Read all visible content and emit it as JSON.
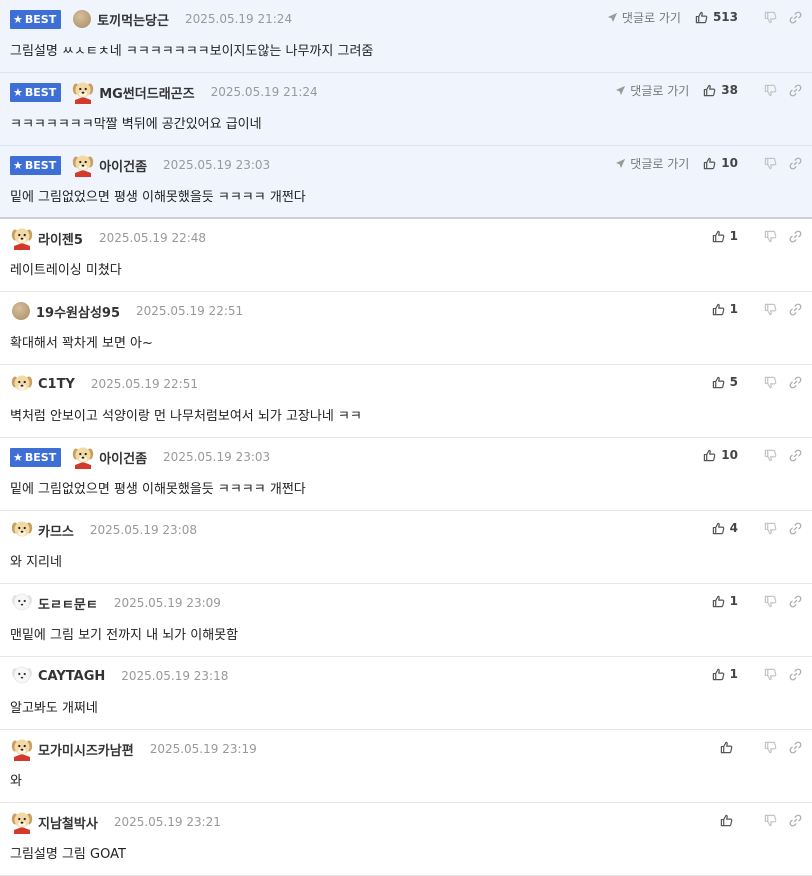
{
  "labels": {
    "best": "BEST",
    "reply": "댓글로 가기"
  },
  "colors": {
    "best_badge": "#3d6fd6",
    "best_bg": "#f0f4fd"
  },
  "comments": [
    {
      "best": true,
      "avatar": "ball",
      "nick": "토끼먹는당근",
      "date": "2025.05.19 21:24",
      "text": "그림설명 ㅆㅅㅌㅊ네 ㅋㅋㅋㅋㅋㅋㅋ보이지도않는 나무까지 그려줌",
      "likes": "513",
      "reply": true
    },
    {
      "best": true,
      "avatar": "dog-red",
      "nick": "MG썬더드래곤즈",
      "date": "2025.05.19 21:24",
      "text": "ㅋㅋㅋㅋㅋㅋㅋ막짤 벽뒤에 공간있어요 급이네",
      "likes": "38",
      "reply": true
    },
    {
      "best": true,
      "avatar": "dog-red",
      "nick": "아이건좀",
      "date": "2025.05.19 23:03",
      "text": "밑에 그림없었으면 평생 이해못했을듯 ㅋㅋㅋㅋ 개쩐다",
      "likes": "10",
      "reply": true
    },
    {
      "best": false,
      "avatar": "dog-red",
      "nick": "라이젠5",
      "date": "2025.05.19 22:48",
      "text": "레이트레이싱 미쳤다",
      "likes": "1",
      "reply": false
    },
    {
      "best": false,
      "avatar": "ball",
      "nick": "19수원삼성95",
      "date": "2025.05.19 22:51",
      "text": "확대해서 꽉차게 보면 아~",
      "likes": "1",
      "reply": false
    },
    {
      "best": false,
      "avatar": "dog",
      "nick": "C1TY",
      "date": "2025.05.19 22:51",
      "text": "벽처럼 안보이고 석양이랑 먼 나무처럼보여서 뇌가 고장나네 ㅋㅋ",
      "likes": "5",
      "reply": false
    },
    {
      "best": true,
      "avatar": "dog-red",
      "nick": "아이건좀",
      "date": "2025.05.19 23:03",
      "text": "밑에 그림없었으면 평생 이해못했을듯 ㅋㅋㅋㅋ 개쩐다",
      "likes": "10",
      "reply": false
    },
    {
      "best": false,
      "avatar": "dog",
      "nick": "카므스",
      "date": "2025.05.19 23:08",
      "text": "와 지리네",
      "likes": "4",
      "reply": false
    },
    {
      "best": false,
      "avatar": "dog-white",
      "nick": "도ㄹㅌ문ㅌ",
      "date": "2025.05.19 23:09",
      "text": "맨밑에 그림 보기 전까지 내 뇌가 이해못함",
      "likes": "1",
      "reply": false
    },
    {
      "best": false,
      "avatar": "dog-white",
      "nick": "CAYTAGH",
      "date": "2025.05.19 23:18",
      "text": "알고봐도 개쩌네",
      "likes": "1",
      "reply": false
    },
    {
      "best": false,
      "avatar": "dog-red",
      "nick": "모가미시즈카남편",
      "date": "2025.05.19 23:19",
      "text": "와",
      "likes": "",
      "reply": false
    },
    {
      "best": false,
      "avatar": "dog-red",
      "nick": "지남철박사",
      "date": "2025.05.19 23:21",
      "text": "그림설명 그림 GOAT",
      "likes": "",
      "reply": false
    }
  ]
}
